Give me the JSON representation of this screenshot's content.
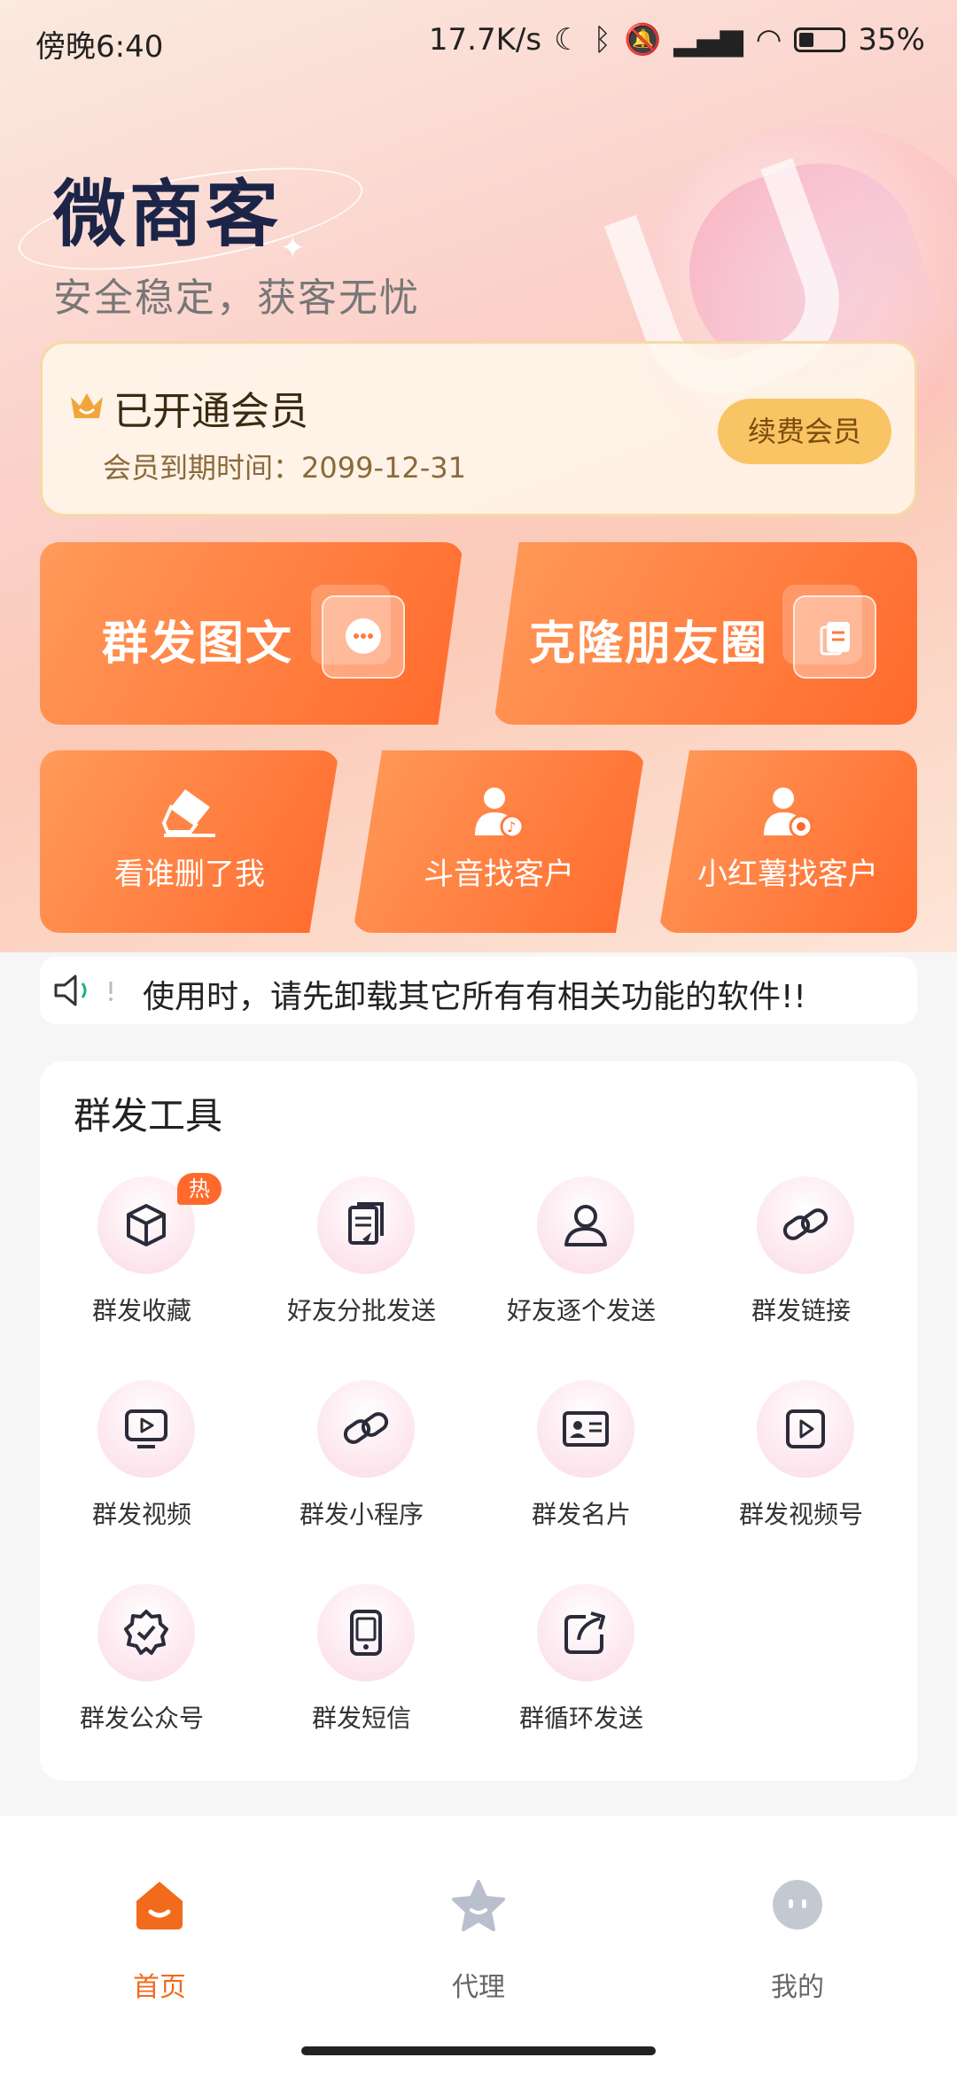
{
  "status_bar": {
    "time": "傍晚6:40",
    "net_speed": "17.7K/s",
    "battery": "35%"
  },
  "header": {
    "title": "微商客",
    "slogan": "安全稳定，获客无忧"
  },
  "vip": {
    "title": "已开通会员",
    "expire": "会员到期时间：2099-12-31",
    "renew_label": "续费会员"
  },
  "actions": {
    "mass_post": "群发图文",
    "clone_moments": "克隆朋友圈",
    "who_deleted": "看谁删了我",
    "douyin": "斗音找客户",
    "xiaohongshu": "小红薯找客户"
  },
  "notice": {
    "text": "使用时，请先卸载其它所有有相关功能的软件!!"
  },
  "tools": {
    "title": "群发工具",
    "hot_badge": "热",
    "items": [
      {
        "label": "群发收藏",
        "icon": "box-icon"
      },
      {
        "label": "好友分批发送",
        "icon": "document-send-icon"
      },
      {
        "label": "好友逐个发送",
        "icon": "user-icon"
      },
      {
        "label": "群发链接",
        "icon": "link-icon"
      },
      {
        "label": "群发视频",
        "icon": "video-screen-icon"
      },
      {
        "label": "群发小程序",
        "icon": "mini-program-icon"
      },
      {
        "label": "群发名片",
        "icon": "id-card-icon"
      },
      {
        "label": "群发视频号",
        "icon": "play-box-icon"
      },
      {
        "label": "群发公众号",
        "icon": "badge-check-icon"
      },
      {
        "label": "群发短信",
        "icon": "phone-icon"
      },
      {
        "label": "群循环发送",
        "icon": "share-out-icon"
      }
    ]
  },
  "tabbar": {
    "home": "首页",
    "agent": "代理",
    "mine": "我的",
    "active_color": "#f26a1c",
    "inactive_color": "#666666"
  }
}
